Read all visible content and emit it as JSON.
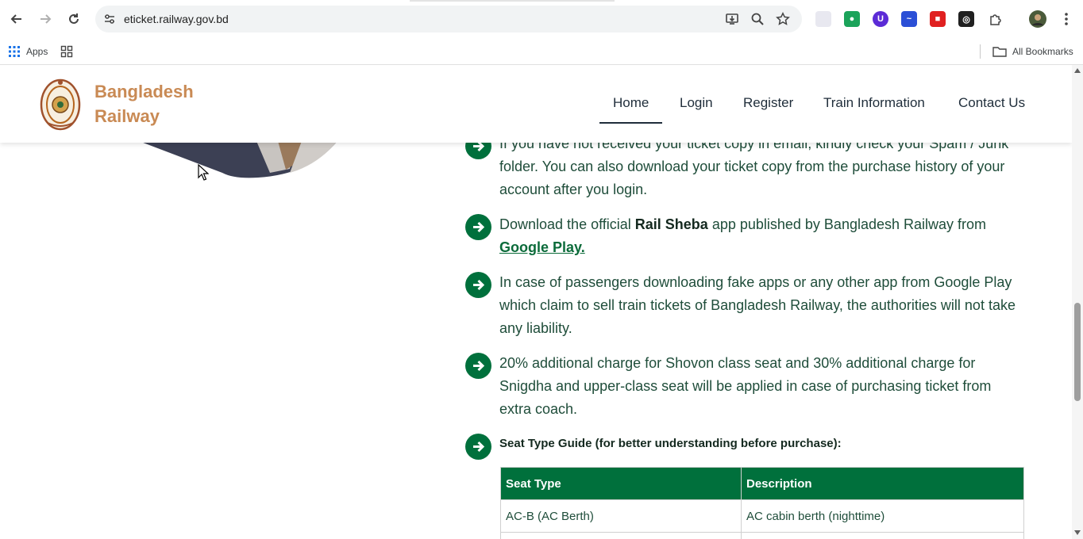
{
  "browser": {
    "url": "eticket.railway.gov.bd",
    "bookmarks": {
      "apps_label": "Apps",
      "all_bookmarks_label": "All Bookmarks"
    }
  },
  "site": {
    "brand_line1": "Bangladesh",
    "brand_line2": "Railway",
    "nav": [
      {
        "label": "Home",
        "active": true
      },
      {
        "label": "Login"
      },
      {
        "label": "Register"
      },
      {
        "label": "Train Information"
      },
      {
        "label": "Contact Us"
      }
    ],
    "accent_color": "#00703c",
    "brand_color": "#c98a54"
  },
  "content": {
    "item1": "If you have not received your ticket copy in email, kindly check your Spam / Junk folder. You can also download your ticket copy from the purchase history of your account after you login.",
    "item2": {
      "pre": "Download the official ",
      "bold": "Rail Sheba",
      "post": " app published by Bangladesh Railway from ",
      "link": "Google Play."
    },
    "item3": "In case of passengers downloading fake apps or any other app from Google Play which claim to sell train tickets of Bangladesh Railway, the authorities will not take any liability.",
    "item4": "20% additional charge for Shovon class seat and 30% additional charge for Snigdha and upper-class seat will be applied in case of purchasing ticket from extra coach.",
    "seat_guide_heading": "Seat Type Guide (for better understanding before purchase):",
    "seat_table": {
      "headers": [
        "Seat Type",
        "Description"
      ],
      "rows": [
        [
          "AC-B (AC Berth)",
          "AC cabin berth (nighttime)"
        ],
        [
          "",
          ""
        ]
      ]
    }
  }
}
